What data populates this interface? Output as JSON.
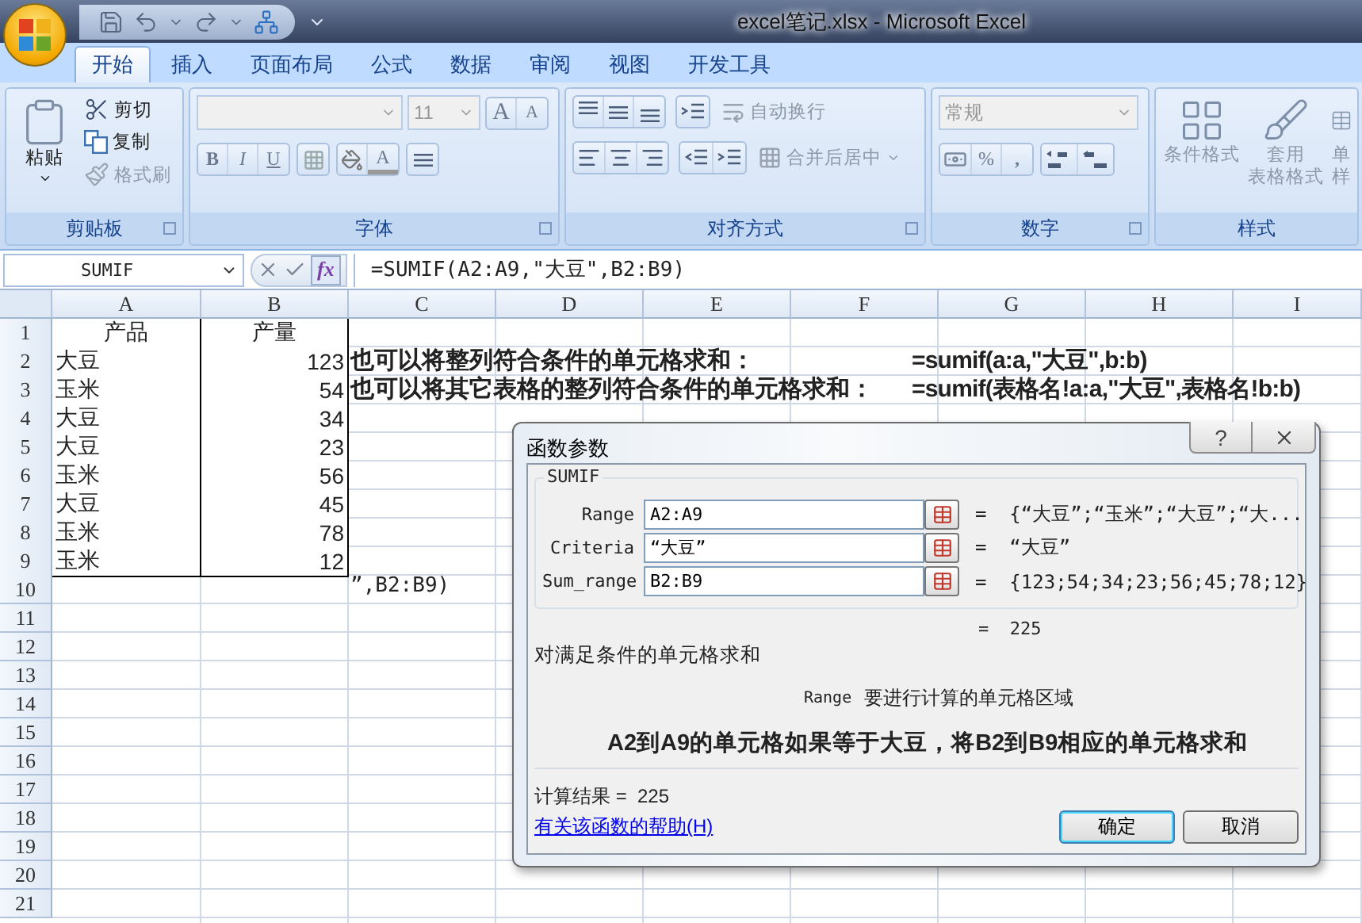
{
  "window": {
    "title": "excel笔记.xlsx - Microsoft Excel"
  },
  "ribbon_tabs": [
    {
      "label": "开始",
      "selected": true
    },
    {
      "label": "插入",
      "selected": false
    },
    {
      "label": "页面布局",
      "selected": false
    },
    {
      "label": "公式",
      "selected": false
    },
    {
      "label": "数据",
      "selected": false
    },
    {
      "label": "审阅",
      "selected": false
    },
    {
      "label": "视图",
      "selected": false
    },
    {
      "label": "开发工具",
      "selected": false
    }
  ],
  "ribbon": {
    "clipboard": {
      "title": "剪贴板",
      "paste": {
        "label": "粘贴",
        "disabled": false
      },
      "commands": [
        {
          "label": "剪切",
          "disabled": false
        },
        {
          "label": "复制",
          "disabled": false
        },
        {
          "label": "格式刷",
          "disabled": true
        }
      ]
    },
    "font": {
      "title": "字体",
      "size": {
        "value": "11",
        "disabled": true
      },
      "grow": "A",
      "shrink": "A",
      "bold": "B",
      "italic": "I",
      "underline": "U",
      "font_color": "A"
    },
    "alignment": {
      "title": "对齐方式",
      "wrap_text": {
        "label": "自动换行",
        "disabled": true
      },
      "merge_center": {
        "label": "合并后居中",
        "disabled": true
      }
    },
    "number": {
      "title": "数字",
      "format": {
        "value": "常规",
        "disabled": true
      },
      "percent": "%",
      "comma": ","
    },
    "styles": {
      "title": "样式",
      "commands": [
        {
          "lines": [
            "条件格式"
          ],
          "disabled": true
        },
        {
          "lines": [
            "套用",
            "表格格式"
          ],
          "disabled": true
        },
        {
          "lines": [
            "单",
            "样"
          ],
          "disabled": true
        }
      ]
    }
  },
  "formula_bar": {
    "name_box": "SUMIF",
    "function_button": "fx",
    "formula": "=SUMIF(A2:A9,\"大豆\",B2:B9)"
  },
  "sheet": {
    "columns": [
      "A",
      "B",
      "C",
      "D",
      "E",
      "F",
      "G",
      "H",
      "I"
    ],
    "rows": [
      {
        "header": "1",
        "kind": "header",
        "cells": [
          "产品",
          "产量"
        ]
      },
      {
        "header": "2",
        "kind": "data",
        "cells": [
          "大豆",
          "123"
        ],
        "note": {
          "text": "也可以将整列符合条件的单元格求和：",
          "formula": "=sumif(a:a,\"大豆\",b:b)"
        }
      },
      {
        "header": "3",
        "kind": "data",
        "cells": [
          "玉米",
          "54"
        ],
        "note": {
          "text": "也可以将其它表格的整列符合条件的单元格求和：",
          "formula": "=sumif(表格名!a:a,\"大豆\",表格名!b:b)"
        }
      },
      {
        "header": "4",
        "kind": "data",
        "cells": [
          "大豆",
          "34"
        ]
      },
      {
        "header": "5",
        "kind": "data",
        "cells": [
          "大豆",
          "23"
        ]
      },
      {
        "header": "6",
        "kind": "data",
        "cells": [
          "玉米",
          "56"
        ]
      },
      {
        "header": "7",
        "kind": "data",
        "cells": [
          "大豆",
          "45"
        ]
      },
      {
        "header": "8",
        "kind": "data",
        "cells": [
          "玉米",
          "78"
        ]
      },
      {
        "header": "9",
        "kind": "data",
        "cells": [
          "玉米",
          "12"
        ]
      },
      {
        "header": "10",
        "kind": "empty",
        "overflow": "”,B2:B9)"
      },
      {
        "header": "11",
        "kind": "empty"
      },
      {
        "header": "12",
        "kind": "empty"
      },
      {
        "header": "13",
        "kind": "empty"
      },
      {
        "header": "14",
        "kind": "empty"
      },
      {
        "header": "15",
        "kind": "empty"
      },
      {
        "header": "16",
        "kind": "empty"
      },
      {
        "header": "17",
        "kind": "empty"
      },
      {
        "header": "18",
        "kind": "empty"
      },
      {
        "header": "19",
        "kind": "empty"
      },
      {
        "header": "20",
        "kind": "empty"
      },
      {
        "header": "21",
        "kind": "empty"
      }
    ]
  },
  "dialog": {
    "title": "函数参数",
    "help_button": "?",
    "function_name": "SUMIF",
    "arguments": [
      {
        "name": "Range",
        "value": "A2:A9",
        "result": "=  {“大豆”;“玉米”;“大豆”;“大..."
      },
      {
        "name": "Criteria",
        "value": "“大豆”",
        "result": "=  “大豆”"
      },
      {
        "name": "Sum_range",
        "value": "B2:B9",
        "result": "=  {123;54;34;23;56;45;78;12}"
      }
    ],
    "total": "=  225",
    "description": "对满足条件的单元格求和",
    "arg_name": "Range",
    "arg_help": "要进行计算的单元格区域",
    "annotation": "A2到A9的单元格如果等于大豆，将B2到B9相应的单元格求和",
    "result_line": "计算结果 =  225",
    "help_link": "有关该函数的帮助(H)",
    "buttons": [
      {
        "label": "确定",
        "selected": true
      },
      {
        "label": "取消",
        "selected": false
      }
    ]
  }
}
